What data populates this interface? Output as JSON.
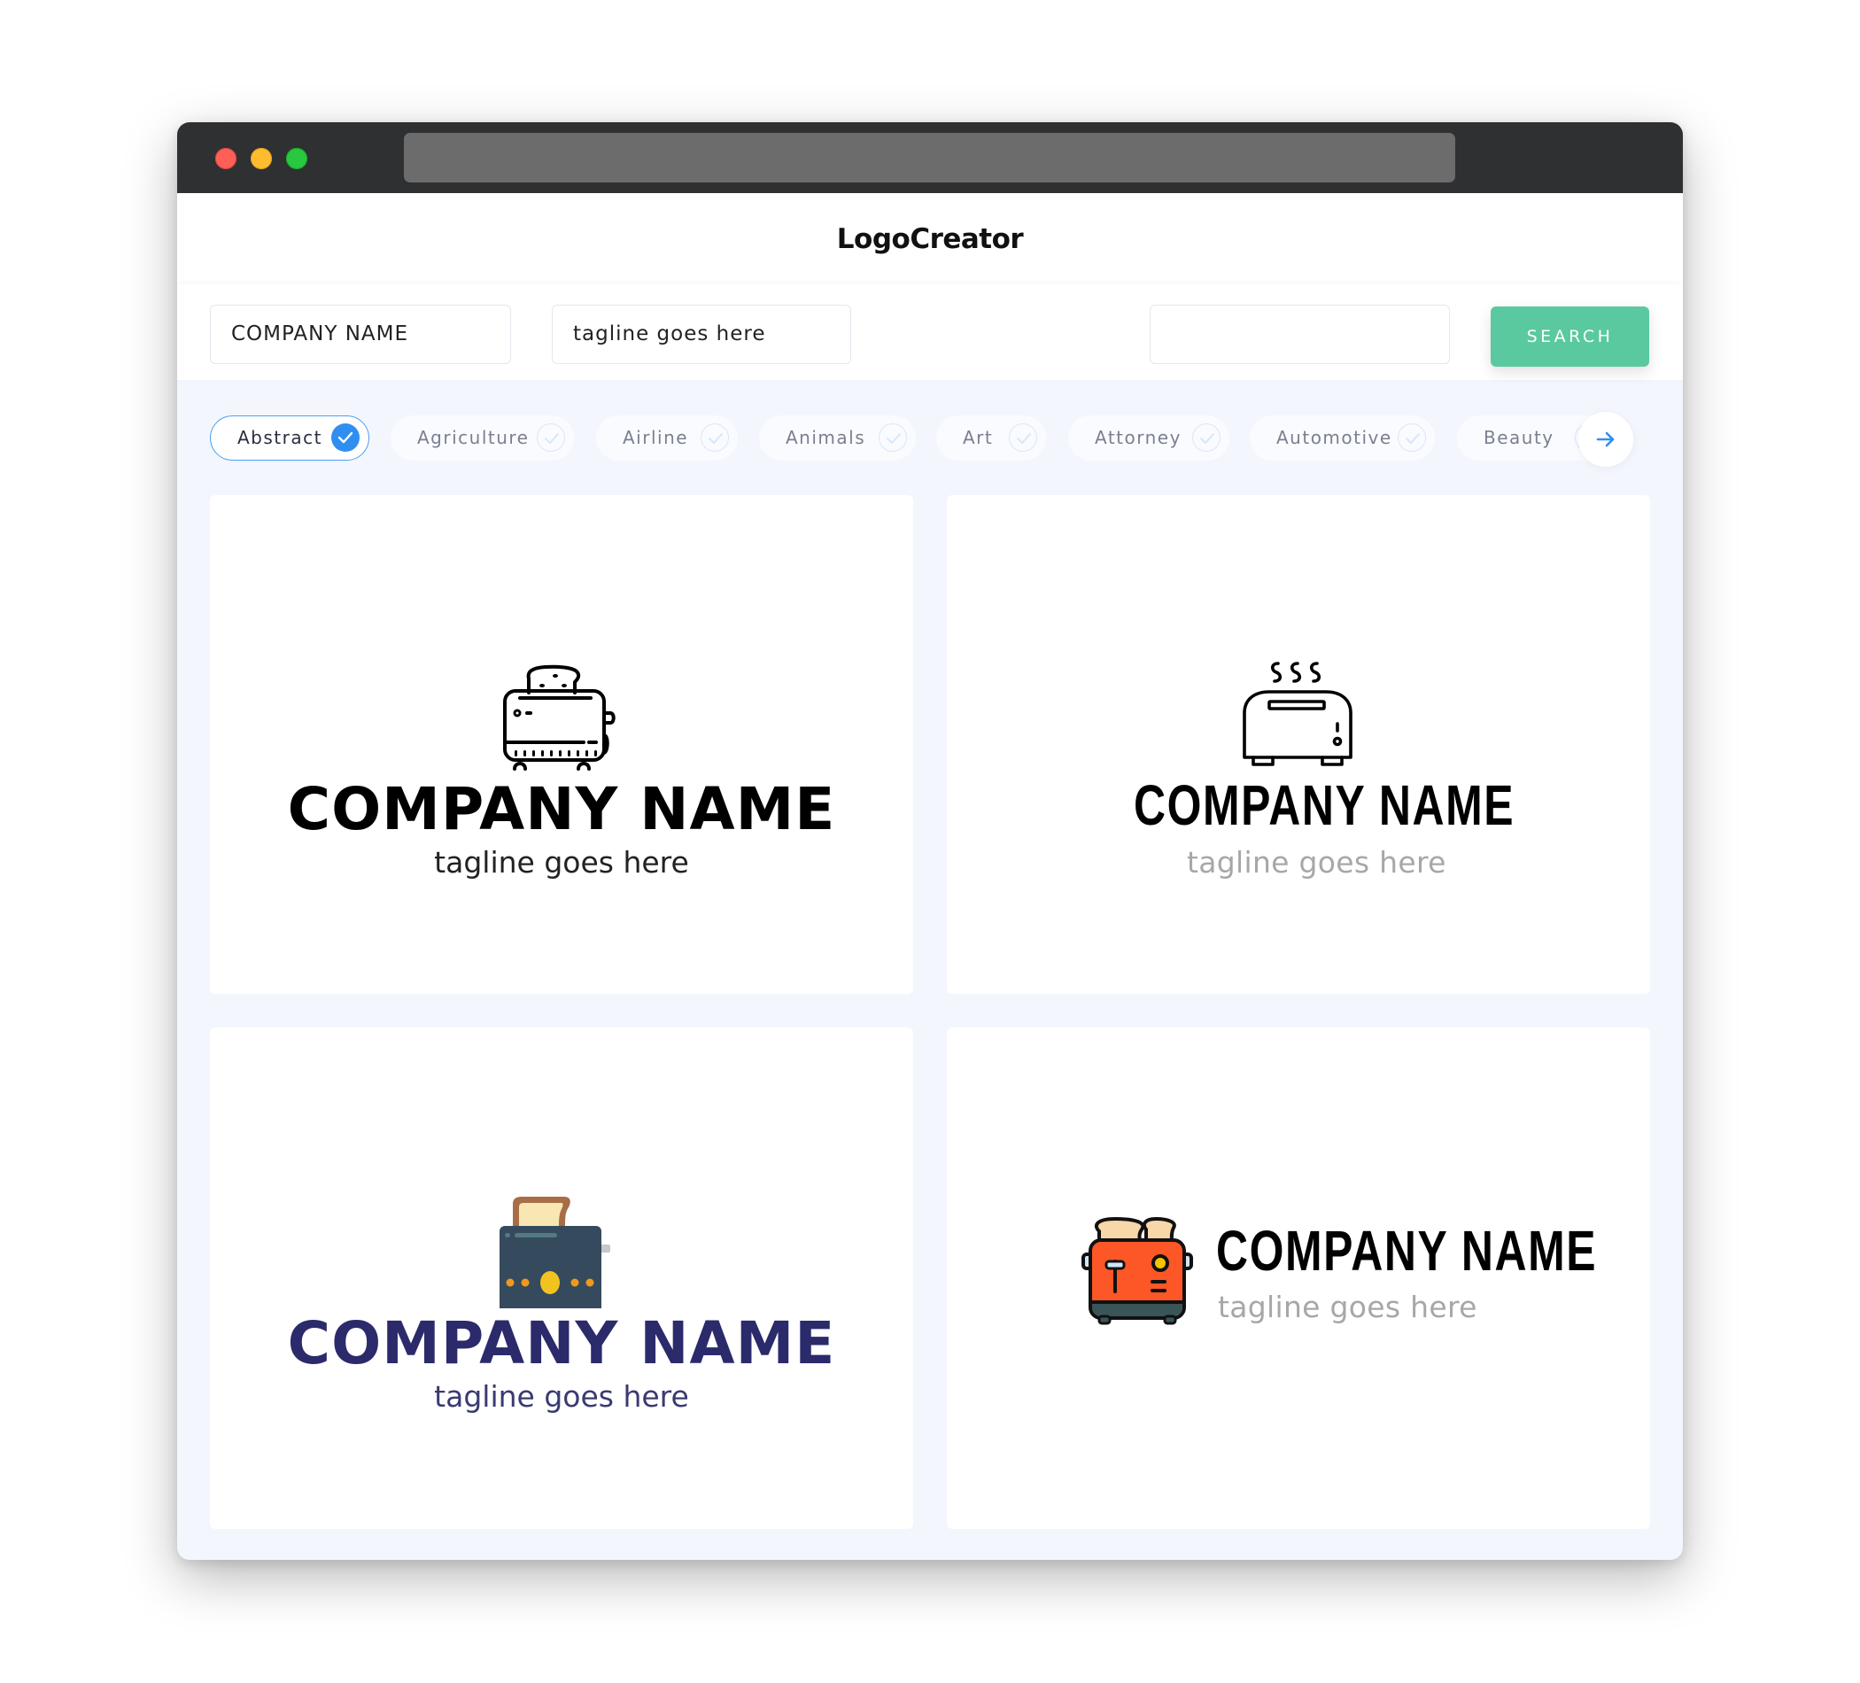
{
  "browser": {
    "url": ""
  },
  "header": {
    "brand": "LogoCreator"
  },
  "search": {
    "company_value": "COMPANY NAME",
    "tagline_value": "tagline goes here",
    "keyword_value": "",
    "button_label": "SEARCH"
  },
  "categories": [
    {
      "label": "Abstract",
      "selected": true
    },
    {
      "label": "Agriculture",
      "selected": false
    },
    {
      "label": "Airline",
      "selected": false
    },
    {
      "label": "Animals",
      "selected": false
    },
    {
      "label": "Art",
      "selected": false
    },
    {
      "label": "Attorney",
      "selected": false
    },
    {
      "label": "Automotive",
      "selected": false
    },
    {
      "label": "Beauty",
      "selected": false
    }
  ],
  "colors": {
    "accent_green": "#5ac9a0",
    "chip_active_blue": "#2f8ff0",
    "navy_text": "#2b2a6b"
  },
  "logos": [
    {
      "icon": "toaster-outline-icon",
      "company": "COMPANY NAME",
      "tagline": "tagline goes here",
      "name_color": "#000000",
      "tagline_color": "#222222"
    },
    {
      "icon": "steaming-toaster-outline-icon",
      "company": "COMPANY NAME",
      "tagline": "tagline goes here",
      "name_color": "#000000",
      "tagline_color": "#a7a7a7"
    },
    {
      "icon": "toaster-flat-navy-icon",
      "company": "COMPANY NAME",
      "tagline": "tagline goes here",
      "name_color": "#2b2a6b",
      "tagline_color": "#3a3a72"
    },
    {
      "icon": "toaster-red-filled-icon",
      "company": "COMPANY NAME",
      "tagline": "tagline goes here",
      "name_color": "#000000",
      "tagline_color": "#a7a7a7"
    }
  ]
}
